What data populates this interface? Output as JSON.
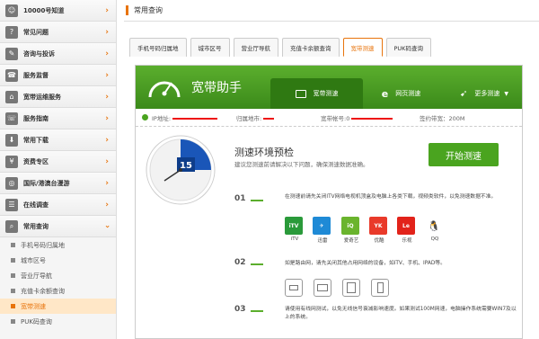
{
  "sidebar": {
    "items": [
      {
        "icon": "person-icon",
        "label": "10000号知道"
      },
      {
        "icon": "question-icon",
        "label": "常见问题"
      },
      {
        "icon": "pencil-icon",
        "label": "咨询与投诉"
      },
      {
        "icon": "phone-icon",
        "label": "服务监督"
      },
      {
        "icon": "broadband-icon",
        "label": "宽带运维服务"
      },
      {
        "icon": "phone-icon",
        "label": "服务指南"
      },
      {
        "icon": "download-icon",
        "label": "常用下载"
      },
      {
        "icon": "money-bag-icon",
        "label": "资费专区"
      },
      {
        "icon": "globe-icon",
        "label": "国际/港澳台漫游"
      },
      {
        "icon": "survey-icon",
        "label": "在线调查"
      },
      {
        "icon": "search-icon",
        "label": "常用查询"
      }
    ],
    "sub_items": [
      "手机号码归属地",
      "城市区号",
      "营业厅导航",
      "充值卡余额查询",
      "宽带测速",
      "PUK码查询"
    ]
  },
  "header": {
    "title": "常用查询"
  },
  "tabs": [
    "手机号码归属地",
    "城市区号",
    "营业厅导航",
    "充值卡余额查询",
    "宽带测速",
    "PUK码查询"
  ],
  "assistant": {
    "title": "宽带助手",
    "tab_speed": "宽带测速",
    "tab_web": "网页测速",
    "tab_more": "更多测速"
  },
  "info": {
    "ip_label": "IP地址:",
    "location_label": "归属地市:",
    "account_label": "宽带帐号:",
    "account_prefix": "0",
    "bandwidth_label": "签约带宽：",
    "bandwidth": "200M"
  },
  "clock": {
    "value": "15"
  },
  "precheck": {
    "title": "测速环境预检",
    "subtitle": "建议您测速前请解决以下问题，确保测速数据准确。",
    "button": "开始测速"
  },
  "steps": [
    {
      "num": "01",
      "text": "在测速前请先关闭ITV网络电视机顶盒及电脑上各类下载，视频类软件，以免测速数据不准。"
    },
    {
      "num": "02",
      "text": "如是路由网，请先关闭其他占用网络的设备，如iTV、手机、IPAD等。"
    },
    {
      "num": "03",
      "text": "请使用有线网测试，以免无线信号衰减影响速度。如果测试100M网速，电脑操作系统需要WIN7及以上的系统。"
    }
  ],
  "apps": [
    {
      "name": "iTV",
      "icon": "itv-app-icon",
      "color": "#2a9a3a"
    },
    {
      "name": "迅雷",
      "icon": "xunlei-app-icon",
      "color": "#1f8ad6"
    },
    {
      "name": "爱奇艺",
      "icon": "iqiyi-app-icon",
      "color": "#6ab42d"
    },
    {
      "name": "优酷",
      "icon": "youku-app-icon",
      "color": "#e93a2a"
    },
    {
      "name": "乐视",
      "icon": "letv-app-icon",
      "color": "#e2231a"
    },
    {
      "name": "QQ",
      "icon": "qq-app-icon",
      "color": "#ffffff"
    }
  ],
  "devices": [
    "itv-device-icon",
    "tv-device-icon",
    "tablet-device-icon",
    "phone-device-icon"
  ],
  "colors": {
    "accent": "#e8740c",
    "green": "#4aa41f",
    "dark_green": "#2f7912"
  }
}
